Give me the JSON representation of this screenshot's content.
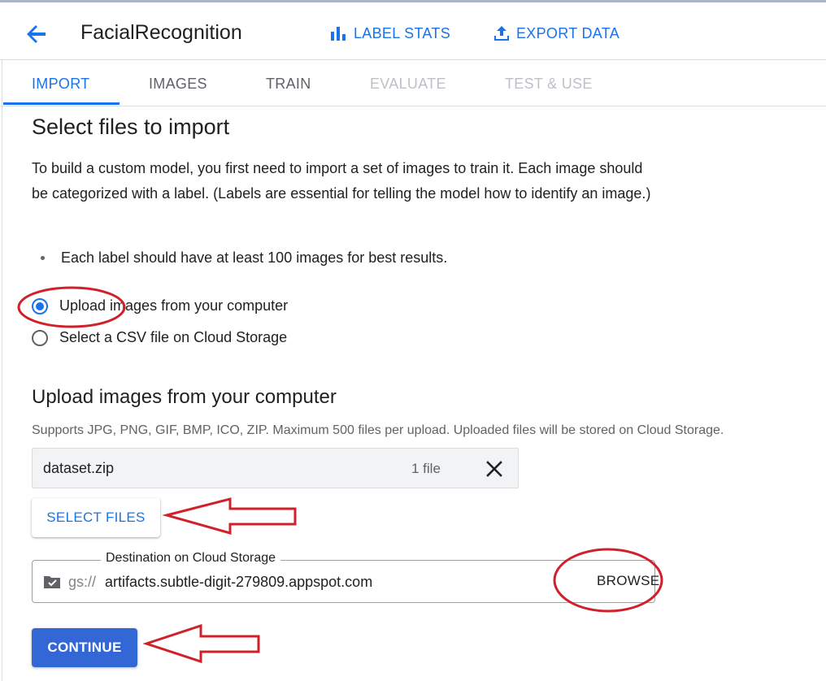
{
  "header": {
    "title": "FacialRecognition",
    "label_stats": "LABEL STATS",
    "export_data": "EXPORT DATA"
  },
  "tabs": [
    {
      "label": "IMPORT",
      "state": "active"
    },
    {
      "label": "IMAGES",
      "state": "enabled"
    },
    {
      "label": "TRAIN",
      "state": "enabled"
    },
    {
      "label": "EVALUATE",
      "state": "disabled"
    },
    {
      "label": "TEST & USE",
      "state": "disabled"
    }
  ],
  "main": {
    "heading": "Select files to import",
    "description": "To build a custom model, you first need to import a set of images to train it. Each image should be categorized with a label. (Labels are essential for telling the model how to identify an image.)",
    "bullet": "Each label should have at least 100 images for best results.",
    "options": [
      {
        "label": "Upload images from your computer",
        "checked": true
      },
      {
        "label": "Select a CSV file on Cloud Storage",
        "checked": false
      }
    ]
  },
  "upload": {
    "heading": "Upload images from your computer",
    "supports": "Supports JPG, PNG, GIF, BMP, ICO, ZIP. Maximum 500 files per upload. Uploaded files will be stored on Cloud Storage.",
    "file_name": "dataset.zip",
    "file_count": "1 file",
    "select_files": "SELECT FILES",
    "destination_label": "Destination on Cloud Storage",
    "destination_prefix": "gs://",
    "destination_path": "artifacts.subtle-digit-279809.appspot.com",
    "browse": "BROWSE",
    "continue": "CONTINUE"
  },
  "colors": {
    "accent": "#1a73e8",
    "primary_button": "#3367d6",
    "annotation": "#d0202a"
  },
  "icons": [
    "back-arrow-icon",
    "bar-chart-icon",
    "upload-icon",
    "close-icon",
    "folder-icon"
  ]
}
